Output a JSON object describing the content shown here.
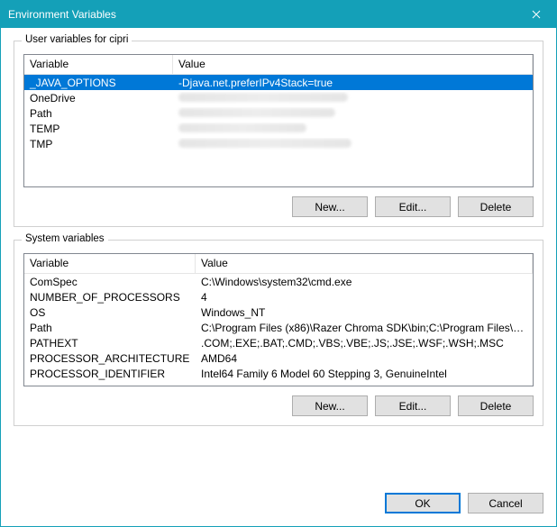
{
  "window": {
    "title": "Environment Variables"
  },
  "user_group": {
    "legend": "User variables for cipri",
    "headers": {
      "variable": "Variable",
      "value": "Value"
    },
    "rows": [
      {
        "variable": "_JAVA_OPTIONS",
        "value": "-Djava.net.preferIPv4Stack=true",
        "selected": true,
        "obscured": false
      },
      {
        "variable": "OneDrive",
        "value": "",
        "selected": false,
        "obscured": true
      },
      {
        "variable": "Path",
        "value": "",
        "selected": false,
        "obscured": true
      },
      {
        "variable": "TEMP",
        "value": "",
        "selected": false,
        "obscured": true
      },
      {
        "variable": "TMP",
        "value": "",
        "selected": false,
        "obscured": true
      }
    ],
    "buttons": {
      "new": "New...",
      "edit": "Edit...",
      "delete": "Delete"
    }
  },
  "system_group": {
    "legend": "System variables",
    "headers": {
      "variable": "Variable",
      "value": "Value"
    },
    "rows": [
      {
        "variable": "ComSpec",
        "value": "C:\\Windows\\system32\\cmd.exe"
      },
      {
        "variable": "NUMBER_OF_PROCESSORS",
        "value": "4"
      },
      {
        "variable": "OS",
        "value": "Windows_NT"
      },
      {
        "variable": "Path",
        "value": "C:\\Program Files (x86)\\Razer Chroma SDK\\bin;C:\\Program Files\\Raz..."
      },
      {
        "variable": "PATHEXT",
        "value": ".COM;.EXE;.BAT;.CMD;.VBS;.VBE;.JS;.JSE;.WSF;.WSH;.MSC"
      },
      {
        "variable": "PROCESSOR_ARCHITECTURE",
        "value": "AMD64"
      },
      {
        "variable": "PROCESSOR_IDENTIFIER",
        "value": "Intel64 Family 6 Model 60 Stepping 3, GenuineIntel"
      }
    ],
    "buttons": {
      "new": "New...",
      "edit": "Edit...",
      "delete": "Delete"
    }
  },
  "footer": {
    "ok": "OK",
    "cancel": "Cancel"
  }
}
